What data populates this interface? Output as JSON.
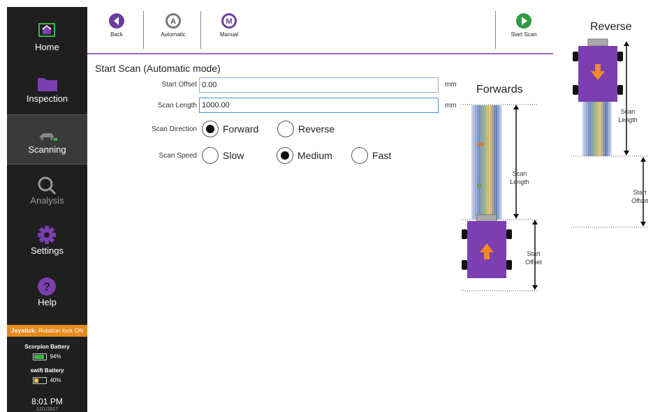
{
  "sidebar": {
    "items": [
      {
        "label": "Home",
        "icon": "home-icon"
      },
      {
        "label": "Inspection",
        "icon": "folder-icon"
      },
      {
        "label": "Scanning",
        "icon": "scanner-icon"
      },
      {
        "label": "Analysis",
        "icon": "magnifier-icon"
      },
      {
        "label": "Settings",
        "icon": "gear-icon"
      },
      {
        "label": "Help",
        "icon": "help-icon"
      }
    ],
    "active": "Scanning",
    "joystick": {
      "label": "Joystick:",
      "value": "Rotation lock ON"
    },
    "batteries": [
      {
        "name": "Scorpion Battery",
        "level": "94%",
        "fraction": 0.94
      },
      {
        "name": "swift Battery",
        "level": "40%",
        "fraction": 0.4
      }
    ],
    "time": "8:01 PM",
    "date": "12/1/2017"
  },
  "toolbar": {
    "back_label": "Back",
    "automatic_label": "Automatic",
    "manual_label": "Manual",
    "start_label": "Start Scan",
    "automatic_letter": "A",
    "manual_letter": "M"
  },
  "form": {
    "title": "Start Scan (Automatic mode)",
    "start_offset": {
      "label": "Start Offset",
      "value": "0.00",
      "unit": "mm"
    },
    "scan_length": {
      "label": "Scan Length",
      "value": "1000.00",
      "unit": "mm"
    },
    "scan_direction": {
      "label": "Scan Direction",
      "options": [
        "Forward",
        "Reverse"
      ],
      "selected": "Forward"
    },
    "scan_speed": {
      "label": "Scan Speed",
      "options": [
        "Slow",
        "Medium",
        "Fast"
      ],
      "selected": "Medium"
    }
  },
  "diagrams": {
    "forwards": {
      "title": "Forwards",
      "scan_length_label": "Scan Length",
      "start_offset_label": "Start Offset"
    },
    "reverse": {
      "title": "Reverse",
      "scan_length_label": "Scan Length",
      "start_offset_label": "Start Offset"
    }
  },
  "colors": {
    "accent_purple": "#6b3fa0",
    "start_green": "#2e9b43",
    "joystick_orange": "#e58a1b",
    "robot_purple": "#7b3fb0",
    "arrow_orange": "#f08a24"
  }
}
